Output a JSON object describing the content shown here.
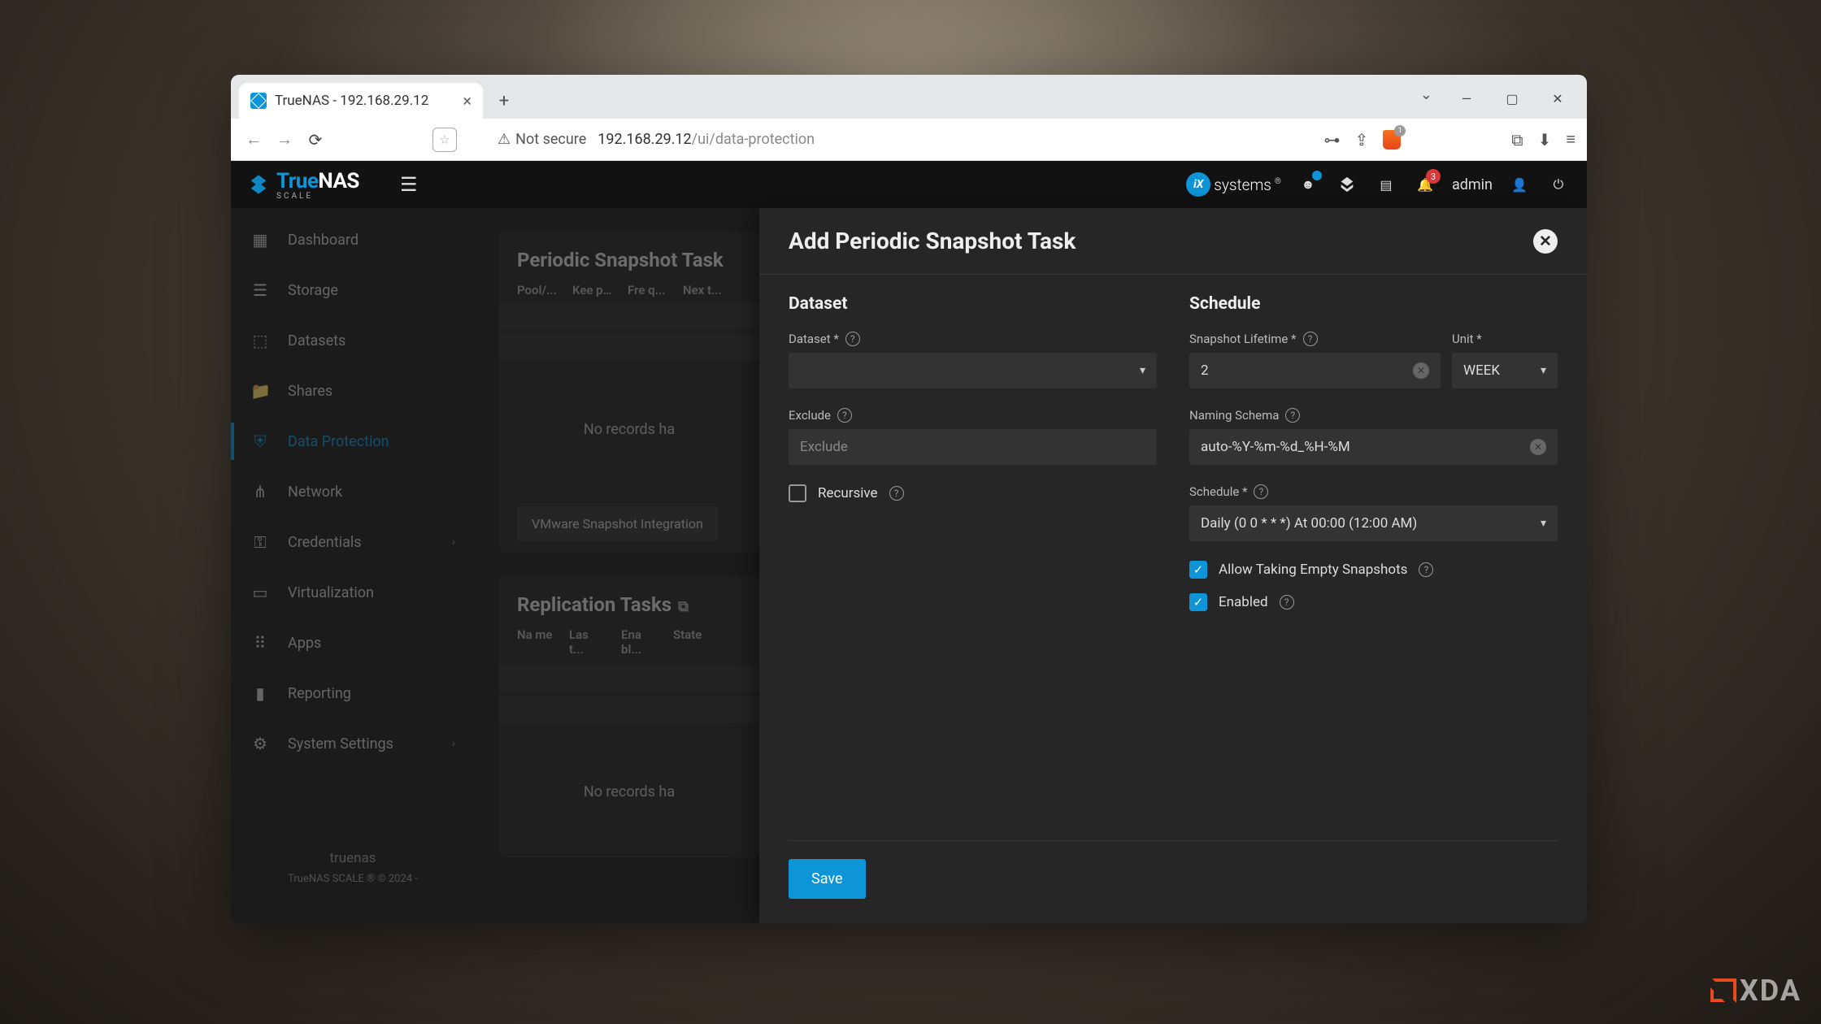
{
  "browser": {
    "tab_title": "TrueNAS - 192.168.29.12",
    "not_secure": "Not secure",
    "url_host": "192.168.29.12",
    "url_path": "/ui/data-protection",
    "shield_badge": "1"
  },
  "header": {
    "logo_main": "True",
    "logo_nas": "NAS",
    "logo_sub": "SCALE",
    "ix": "systems",
    "bell_badge": "3",
    "user": "admin"
  },
  "sidebar": {
    "items": [
      {
        "label": "Dashboard"
      },
      {
        "label": "Storage"
      },
      {
        "label": "Datasets"
      },
      {
        "label": "Shares"
      },
      {
        "label": "Data Protection"
      },
      {
        "label": "Network"
      },
      {
        "label": "Credentials"
      },
      {
        "label": "Virtualization"
      },
      {
        "label": "Apps"
      },
      {
        "label": "Reporting"
      },
      {
        "label": "System Settings"
      }
    ],
    "hostname": "truenas",
    "copyright": "TrueNAS SCALE ® © 2024 -"
  },
  "main": {
    "snap_title": "Periodic Snapshot Task",
    "snap_cols": [
      "Pool/...",
      "Kee p...",
      "Fre q...",
      "Nex t..."
    ],
    "no_records": "No records ha",
    "vmware_btn": "VMware Snapshot Integration",
    "repl_title": "Replication Tasks",
    "repl_cols": [
      "Na me",
      "Las t...",
      "Ena bl...",
      "State"
    ]
  },
  "panel": {
    "title": "Add Periodic Snapshot Task",
    "left_h": "Dataset",
    "dataset_label": "Dataset *",
    "exclude_label": "Exclude",
    "exclude_placeholder": "Exclude",
    "recursive_label": "Recursive",
    "right_h": "Schedule",
    "lifetime_label": "Snapshot Lifetime *",
    "lifetime_value": "2",
    "unit_label": "Unit *",
    "unit_value": "WEEK",
    "schema_label": "Naming Schema",
    "schema_value": "auto-%Y-%m-%d_%H-%M",
    "schedule_label": "Schedule *",
    "schedule_value": "Daily (0 0 * * *)  At 00:00 (12:00 AM)",
    "allow_empty": "Allow Taking Empty Snapshots",
    "enabled": "Enabled",
    "save": "Save"
  },
  "watermark": "XDA"
}
